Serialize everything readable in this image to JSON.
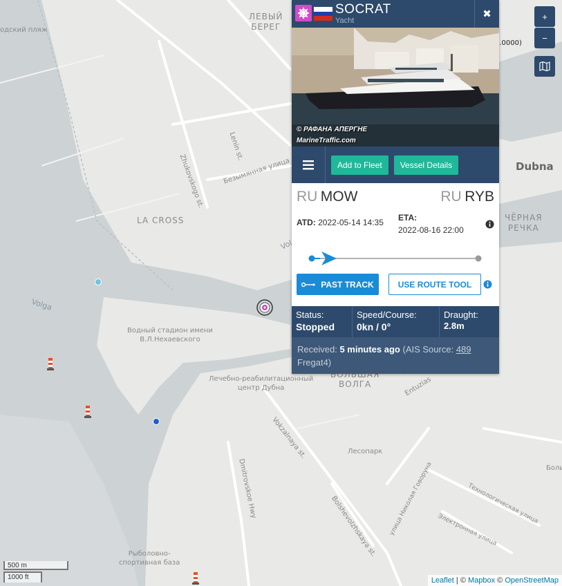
{
  "map": {
    "labels": {
      "left_bank": [
        "ЛЕВЫЙ",
        "БЕРЕГ"
      ],
      "beach": "одский пляж",
      "lenin": "Lenin st.",
      "zhukovskogo": "Zhukovskogo st.",
      "bezymyannaya": "Безымянная улица",
      "la_cross": "LA CROSS",
      "volga_river": "Volga",
      "volga_partial": "Vol",
      "stadium": [
        "Водный стадион имени",
        "В.Л.Нехаевского"
      ],
      "rehab": [
        "Лечебно-реабилитационный",
        "центр Дубна"
      ],
      "bolshaya_volga": [
        "БОЛЬШАЯ",
        "ВОЛГА"
      ],
      "entuziastov": "Entuzias",
      "dubna": "Dubna",
      "chernaya_rechka": [
        "ЧЁРНАЯ",
        "РЕЧКА"
      ],
      "vokzalnaya": "Vokzalnaya st.",
      "lesopark": "Лесопарк",
      "dmitrovskoe": "Dmitrovskoe Hwy",
      "bolshevolzhskaya": "Bolshevolzhskaya st.",
      "nikolaya_govorunа": "улица Николая Говоруна",
      "tekhnologicheskaya": "Технологическая улица",
      "elektronnaya": "Электронная улица",
      "fishing": [
        "Рыболовно-",
        "спортивная база"
      ],
      "bolsh_partial": "Боль"
    },
    "coords_readout": [
      "0",
      "0",
      "0.0000)"
    ],
    "zoom_in": "+",
    "zoom_out": "−",
    "scale": {
      "metric": "500 m",
      "imperial": "1000 ft"
    },
    "attribution": {
      "leaflet": "Leaflet",
      "sep1": " | © ",
      "mapbox": "Mapbox",
      "sep2": " © ",
      "osm": "OpenStreetMap"
    }
  },
  "popup": {
    "vessel_name": "SOCRAT",
    "vessel_type": "Yacht",
    "close": "✖",
    "photo_credit": [
      "© РАФАНА АПЕРГНЕ",
      "MarineTraffic.com"
    ],
    "add_to_fleet": "Add to Fleet",
    "vessel_details": "Vessel Details",
    "departure": {
      "country": "RU",
      "port": "MOW"
    },
    "arrival": {
      "country": "RU",
      "port": "RYB"
    },
    "atd_label": "ATD:",
    "atd_value": "2022-05-14 14:35",
    "eta_label": "ETA:",
    "eta_value": "2022-08-16 22:00",
    "progress": 0.05,
    "past_track": "PAST TRACK",
    "route_tool": "USE ROUTE TOOL",
    "status_label": "Status:",
    "status_value": "Stopped",
    "speed_label": "Speed/Course:",
    "speed_value": "0kn / 0°",
    "draught_label": "Draught:",
    "draught_value": "2.8m",
    "received_label": "Received:",
    "received_value": "5 minutes ago",
    "ais_prefix": "(AIS Source:",
    "ais_id": "489",
    "ais_suffix": "Fregat4)"
  }
}
